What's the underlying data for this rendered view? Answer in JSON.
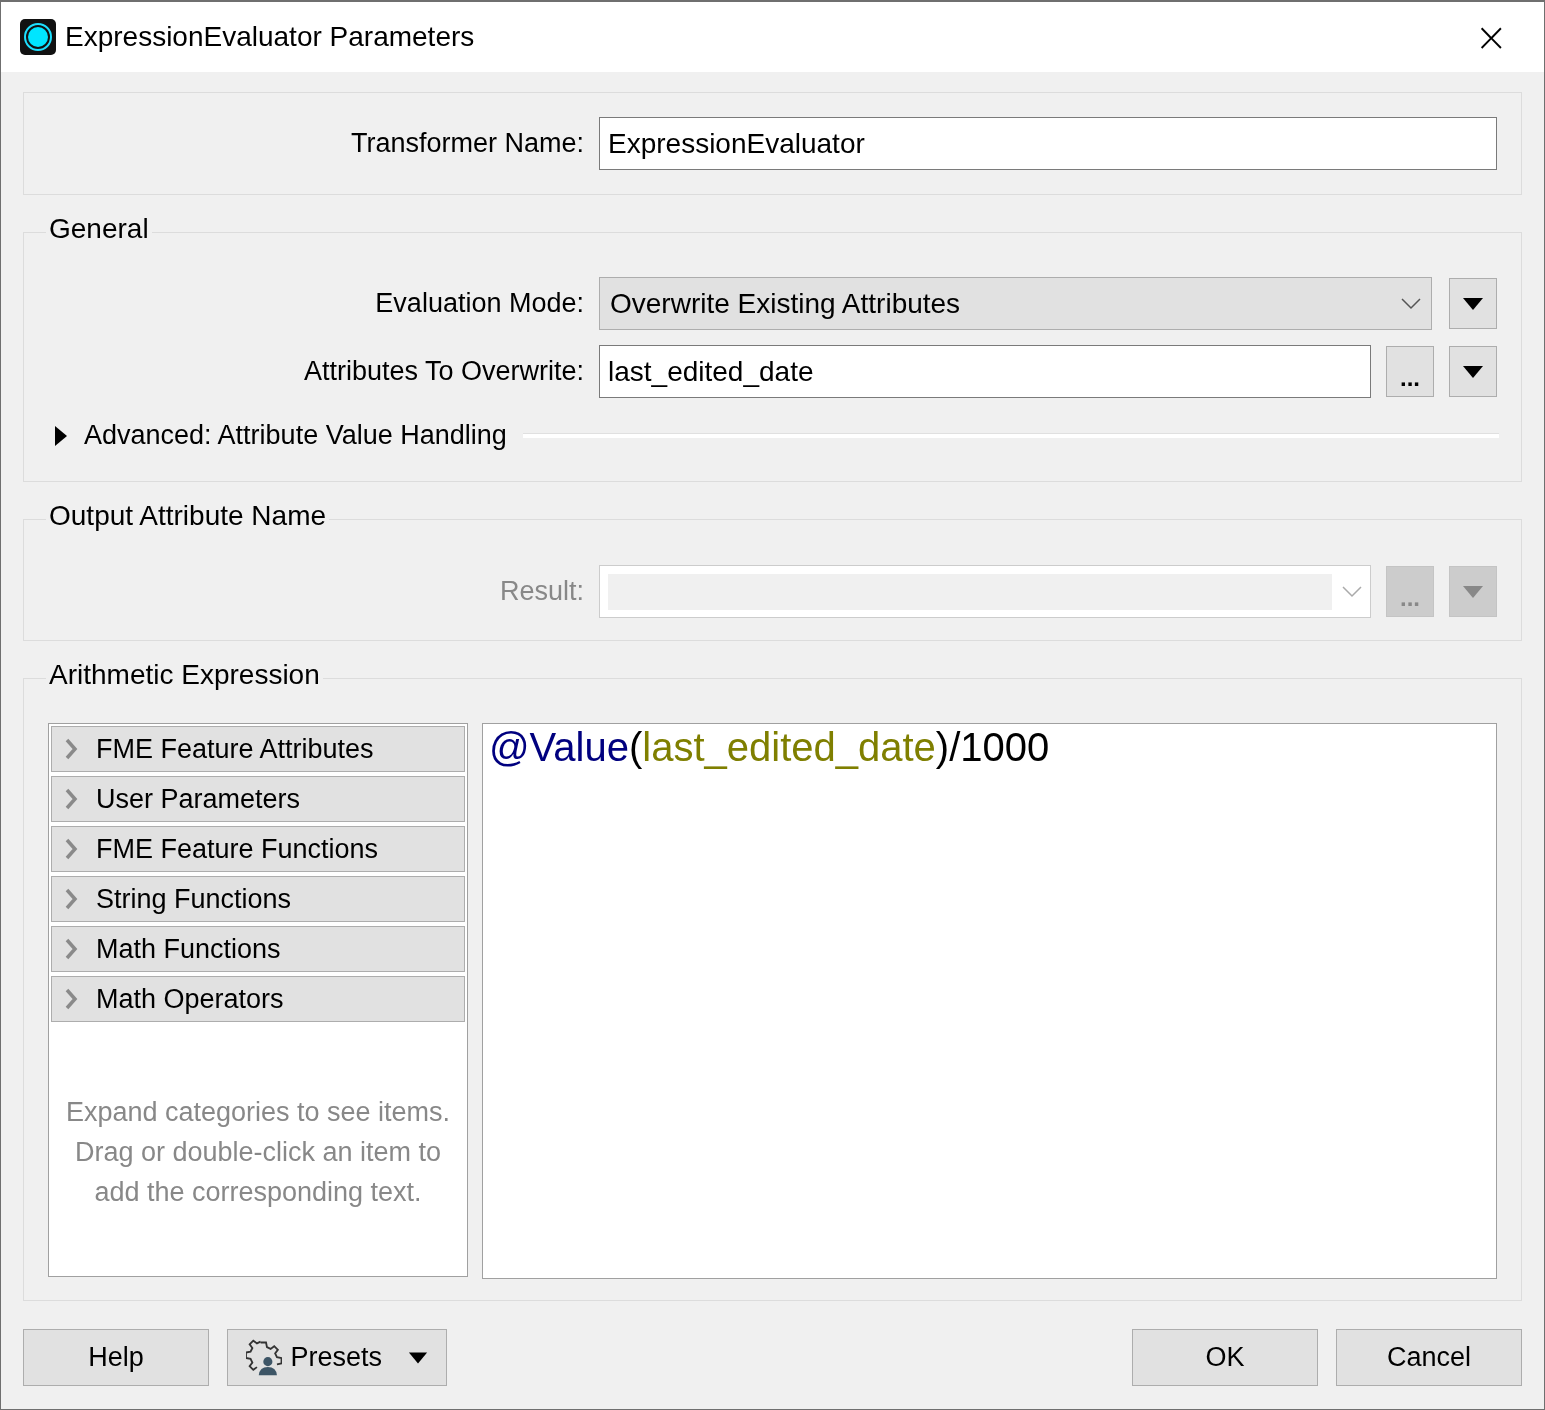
{
  "window": {
    "title": "ExpressionEvaluator Parameters",
    "close": "×"
  },
  "transformer_name": {
    "label": "Transformer Name:",
    "value": "ExpressionEvaluator"
  },
  "general": {
    "title": "General",
    "evaluation_mode": {
      "label": "Evaluation Mode:",
      "value": "Overwrite Existing Attributes"
    },
    "attributes_to_overwrite": {
      "label": "Attributes To Overwrite:",
      "value": "last_edited_date",
      "ellipsis": "..."
    },
    "advanced": {
      "label": "Advanced: Attribute Value Handling",
      "expanded": false
    }
  },
  "output_attribute_name": {
    "title": "Output Attribute Name",
    "result": {
      "label": "Result:",
      "disabled": true,
      "ellipsis": "..."
    }
  },
  "arithmetic_expression": {
    "title": "Arithmetic Expression",
    "categories": [
      {
        "label": "FME Feature Attributes",
        "expanded": false
      },
      {
        "label": "User Parameters",
        "expanded": false
      },
      {
        "label": "FME Feature Functions",
        "expanded": false
      },
      {
        "label": "String Functions",
        "expanded": false
      },
      {
        "label": "Math Functions",
        "expanded": false
      },
      {
        "label": "Math Operators",
        "expanded": false
      }
    ],
    "hint": "Expand categories to see items. Drag or double-click an item to add the corresponding text.",
    "expression": [
      {
        "kind": "function",
        "text": "@Value"
      },
      {
        "kind": "plain",
        "text": "("
      },
      {
        "kind": "attribute",
        "text": "last_edited_date"
      },
      {
        "kind": "plain",
        "text": ")/1000"
      }
    ]
  },
  "buttons": {
    "help": "Help",
    "presets": "Presets",
    "ok": "OK",
    "cancel": "Cancel"
  }
}
